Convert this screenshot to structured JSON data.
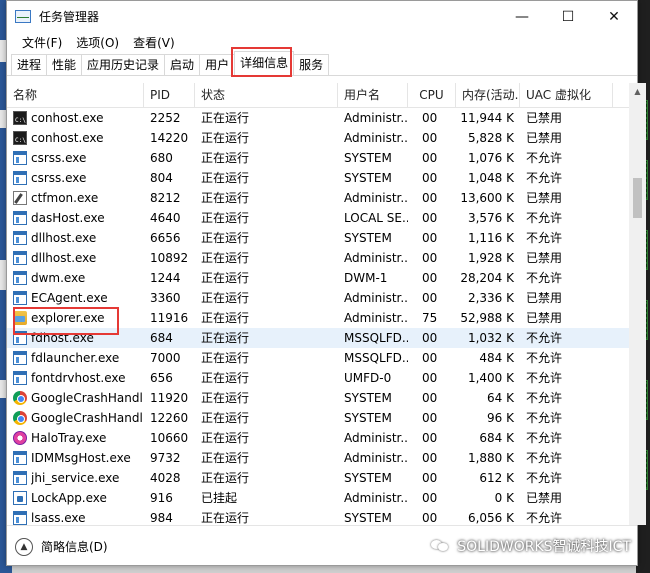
{
  "window": {
    "title": "任务管理器",
    "minimize_symbol": "—",
    "maximize_symbol": "☐",
    "close_symbol": "✕"
  },
  "menu": [
    "文件(F)",
    "选项(O)",
    "查看(V)"
  ],
  "tabs": [
    {
      "label": "进程",
      "active": false
    },
    {
      "label": "性能",
      "active": false
    },
    {
      "label": "应用历史记录",
      "active": false
    },
    {
      "label": "启动",
      "active": false
    },
    {
      "label": "用户",
      "active": false
    },
    {
      "label": "详细信息",
      "active": true
    },
    {
      "label": "服务",
      "active": false
    }
  ],
  "columns": {
    "name": "名称",
    "pid": "PID",
    "status": "状态",
    "user": "用户名",
    "cpu": "CPU",
    "mem": "内存(活动...",
    "uac": "UAC 虚拟化"
  },
  "rows": [
    {
      "icon": "console-icon",
      "name": "conhost.exe",
      "pid": "2252",
      "status": "正在运行",
      "user": "Administr...",
      "cpu": "00",
      "mem": "11,944 K",
      "uac": "已禁用"
    },
    {
      "icon": "console-icon",
      "name": "conhost.exe",
      "pid": "14220",
      "status": "正在运行",
      "user": "Administr...",
      "cpu": "00",
      "mem": "5,828 K",
      "uac": "已禁用"
    },
    {
      "icon": "window-icon",
      "name": "csrss.exe",
      "pid": "680",
      "status": "正在运行",
      "user": "SYSTEM",
      "cpu": "00",
      "mem": "1,076 K",
      "uac": "不允许"
    },
    {
      "icon": "window-icon",
      "name": "csrss.exe",
      "pid": "804",
      "status": "正在运行",
      "user": "SYSTEM",
      "cpu": "00",
      "mem": "1,048 K",
      "uac": "不允许"
    },
    {
      "icon": "pen-icon",
      "name": "ctfmon.exe",
      "pid": "8212",
      "status": "正在运行",
      "user": "Administr...",
      "cpu": "00",
      "mem": "13,600 K",
      "uac": "已禁用"
    },
    {
      "icon": "window-icon",
      "name": "dasHost.exe",
      "pid": "4640",
      "status": "正在运行",
      "user": "LOCAL SE...",
      "cpu": "00",
      "mem": "3,576 K",
      "uac": "不允许"
    },
    {
      "icon": "window-icon",
      "name": "dllhost.exe",
      "pid": "6656",
      "status": "正在运行",
      "user": "SYSTEM",
      "cpu": "00",
      "mem": "1,116 K",
      "uac": "不允许"
    },
    {
      "icon": "window-icon",
      "name": "dllhost.exe",
      "pid": "10892",
      "status": "正在运行",
      "user": "Administr...",
      "cpu": "00",
      "mem": "1,928 K",
      "uac": "已禁用"
    },
    {
      "icon": "window-icon",
      "name": "dwm.exe",
      "pid": "1244",
      "status": "正在运行",
      "user": "DWM-1",
      "cpu": "00",
      "mem": "28,204 K",
      "uac": "不允许"
    },
    {
      "icon": "window-icon",
      "name": "ECAgent.exe",
      "pid": "3360",
      "status": "正在运行",
      "user": "Administr...",
      "cpu": "00",
      "mem": "2,336 K",
      "uac": "已禁用"
    },
    {
      "icon": "folder-icon",
      "name": "explorer.exe",
      "pid": "11916",
      "status": "正在运行",
      "user": "Administr...",
      "cpu": "75",
      "mem": "52,988 K",
      "uac": "已禁用"
    },
    {
      "icon": "window-icon",
      "name": "fdhost.exe",
      "pid": "684",
      "status": "正在运行",
      "user": "MSSQLFD...",
      "cpu": "00",
      "mem": "1,032 K",
      "uac": "不允许",
      "selected": true
    },
    {
      "icon": "window-icon",
      "name": "fdlauncher.exe",
      "pid": "7000",
      "status": "正在运行",
      "user": "MSSQLFD...",
      "cpu": "00",
      "mem": "484 K",
      "uac": "不允许"
    },
    {
      "icon": "window-icon",
      "name": "fontdrvhost.exe",
      "pid": "656",
      "status": "正在运行",
      "user": "UMFD-0",
      "cpu": "00",
      "mem": "1,400 K",
      "uac": "不允许"
    },
    {
      "icon": "chrome-icon",
      "name": "GoogleCrashHandl...",
      "pid": "11920",
      "status": "正在运行",
      "user": "SYSTEM",
      "cpu": "00",
      "mem": "64 K",
      "uac": "不允许"
    },
    {
      "icon": "chrome-icon",
      "name": "GoogleCrashHandl...",
      "pid": "12260",
      "status": "正在运行",
      "user": "SYSTEM",
      "cpu": "00",
      "mem": "96 K",
      "uac": "不允许"
    },
    {
      "icon": "halo-icon",
      "name": "HaloTray.exe",
      "pid": "10660",
      "status": "正在运行",
      "user": "Administr...",
      "cpu": "00",
      "mem": "684 K",
      "uac": "不允许"
    },
    {
      "icon": "window-icon",
      "name": "IDMMsgHost.exe",
      "pid": "9732",
      "status": "正在运行",
      "user": "Administr...",
      "cpu": "00",
      "mem": "1,880 K",
      "uac": "不允许"
    },
    {
      "icon": "window-icon",
      "name": "jhi_service.exe",
      "pid": "4028",
      "status": "正在运行",
      "user": "SYSTEM",
      "cpu": "00",
      "mem": "612 K",
      "uac": "不允许"
    },
    {
      "icon": "lock-icon",
      "name": "LockApp.exe",
      "pid": "916",
      "status": "已挂起",
      "user": "Administr...",
      "cpu": "00",
      "mem": "0 K",
      "uac": "已禁用"
    },
    {
      "icon": "window-icon",
      "name": "lsass.exe",
      "pid": "984",
      "status": "正在运行",
      "user": "SYSTEM",
      "cpu": "00",
      "mem": "6,056 K",
      "uac": "不允许"
    }
  ],
  "footer": {
    "fewer_details": "简略信息(D)",
    "watermark": "SOLIDWORKS智诚科技ICT"
  }
}
